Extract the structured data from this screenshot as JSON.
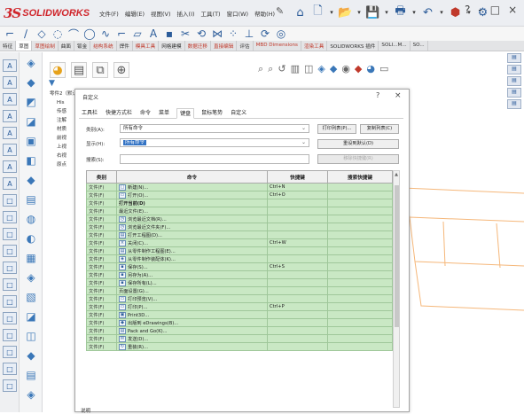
{
  "app": {
    "logo_ds": "3S",
    "logo_name": "SOLIDWORKS",
    "menus": [
      "文件(F)",
      "编辑(E)",
      "视图(V)",
      "插入(I)",
      "工具(T)",
      "窗口(W)",
      "帮助(H)"
    ],
    "window_controls": [
      "?",
      "-",
      "□",
      "×"
    ]
  },
  "command_tabs": [
    {
      "label": "特征",
      "active": false,
      "red": false
    },
    {
      "label": "草图",
      "active": true,
      "red": false
    },
    {
      "label": "草图绘制",
      "active": false,
      "red": true
    },
    {
      "label": "曲面",
      "active": false,
      "red": false
    },
    {
      "label": "钣金",
      "active": false,
      "red": false
    },
    {
      "label": "结构系统",
      "active": false,
      "red": true
    },
    {
      "label": "焊件",
      "active": false,
      "red": false
    },
    {
      "label": "模具工具",
      "active": false,
      "red": true
    },
    {
      "label": "网格建模",
      "active": false,
      "red": false
    },
    {
      "label": "数据迁移",
      "active": false,
      "red": true
    },
    {
      "label": "直接编辑",
      "active": false,
      "red": true
    },
    {
      "label": "评估",
      "active": false,
      "red": false
    },
    {
      "label": "MBD Dimensions",
      "active": false,
      "red": true
    },
    {
      "label": "渲染工具",
      "active": false,
      "red": true
    },
    {
      "label": "SOLIDWORKS 插件",
      "active": false,
      "red": false
    },
    {
      "label": "SOLI...M...",
      "active": false,
      "red": false
    },
    {
      "label": "SO...",
      "active": false,
      "red": false
    }
  ],
  "tree": {
    "root": "零件2（默认<<默",
    "items": [
      "His",
      "传感",
      "注解",
      "材质",
      "前视",
      "上视",
      "右视",
      "原点"
    ]
  },
  "dialog": {
    "title": "自定义",
    "help": "?",
    "close": "×",
    "tabs": [
      {
        "label": "工具栏",
        "active": false
      },
      {
        "label": "快捷方式栏",
        "active": false
      },
      {
        "label": "命令",
        "active": false
      },
      {
        "label": "菜单",
        "active": false
      },
      {
        "label": "键盘",
        "active": true
      },
      {
        "label": "鼠标笔势",
        "active": false
      },
      {
        "label": "自定义",
        "active": false
      }
    ],
    "category_label": "类别(A):",
    "category_value": "所有命令",
    "show_label": "显示(H):",
    "show_value": "所有命令",
    "search_label": "搜索(S):",
    "search_value": "",
    "buttons": {
      "print_list": "打印列表(P)...",
      "copy_list": "复制列表(C)",
      "reset_default": "重设到默认(D)",
      "remove_shortcut": "移除快捷键(R)"
    },
    "table": {
      "headers": [
        "类别",
        "命令",
        "快捷键",
        "搜索快捷键"
      ],
      "rows": [
        {
          "cat": "文件(F)",
          "icon": "new-document-icon",
          "cmd": "新建(N)...",
          "key": "Ctrl+N",
          "bold": false
        },
        {
          "cat": "文件(F)",
          "icon": "open-folder-icon",
          "cmd": "打开(O)...",
          "key": "Ctrl+O",
          "bold": false
        },
        {
          "cat": "文件(F)",
          "icon": "",
          "cmd": "打开当前(D)",
          "key": "",
          "bold": true
        },
        {
          "cat": "文件(F)",
          "icon": "",
          "cmd": "最近文件(E)...",
          "key": "",
          "bold": false
        },
        {
          "cat": "文件(F)",
          "icon": "browse-recent-icon",
          "cmd": "浏览最近文档(R)...",
          "key": "",
          "bold": false
        },
        {
          "cat": "文件(F)",
          "icon": "browse-recent-folder-icon",
          "cmd": "浏览最近文件夹(F)...",
          "key": "",
          "bold": false
        },
        {
          "cat": "文件(F)",
          "icon": "open-drawing-icon",
          "cmd": "打开工程图(D)...",
          "key": "",
          "bold": false
        },
        {
          "cat": "文件(F)",
          "icon": "close-icon",
          "cmd": "关闭(C)...",
          "key": "Ctrl+W",
          "bold": false
        },
        {
          "cat": "文件(F)",
          "icon": "make-drawing-icon",
          "cmd": "从零件制作工程图(E)...",
          "key": "",
          "bold": false
        },
        {
          "cat": "文件(F)",
          "icon": "make-assembly-icon",
          "cmd": "从零件制作装配体(K)...",
          "key": "",
          "bold": false
        },
        {
          "cat": "文件(F)",
          "icon": "save-icon",
          "cmd": "保存(S)...",
          "key": "Ctrl+S",
          "bold": false
        },
        {
          "cat": "文件(F)",
          "icon": "save-as-icon",
          "cmd": "另存为(A)...",
          "key": "",
          "bold": false
        },
        {
          "cat": "文件(F)",
          "icon": "save-all-icon",
          "cmd": "保存所有(L)...",
          "key": "",
          "bold": false
        },
        {
          "cat": "文件(F)",
          "icon": "",
          "cmd": "页面设置(G)...",
          "key": "",
          "bold": false
        },
        {
          "cat": "文件(F)",
          "icon": "print-preview-icon",
          "cmd": "打印预览(V)...",
          "key": "",
          "bold": false
        },
        {
          "cat": "文件(F)",
          "icon": "print-icon",
          "cmd": "打印(P)...",
          "key": "Ctrl+P",
          "bold": false
        },
        {
          "cat": "文件(F)",
          "icon": "print3d-icon",
          "cmd": "Print3D...",
          "key": "",
          "bold": false
        },
        {
          "cat": "文件(F)",
          "icon": "edrawings-icon",
          "cmd": "出版到 eDrawings(B)...",
          "key": "",
          "bold": false
        },
        {
          "cat": "文件(F)",
          "icon": "pack-and-go-icon",
          "cmd": "Pack and Go(K)...",
          "key": "",
          "bold": false
        },
        {
          "cat": "文件(F)",
          "icon": "send-icon",
          "cmd": "发送(D)...",
          "key": "",
          "bold": false
        },
        {
          "cat": "文件(F)",
          "icon": "reload-icon",
          "cmd": "重装(R)...",
          "key": "",
          "bold": false
        }
      ]
    },
    "description_label": "说明"
  }
}
